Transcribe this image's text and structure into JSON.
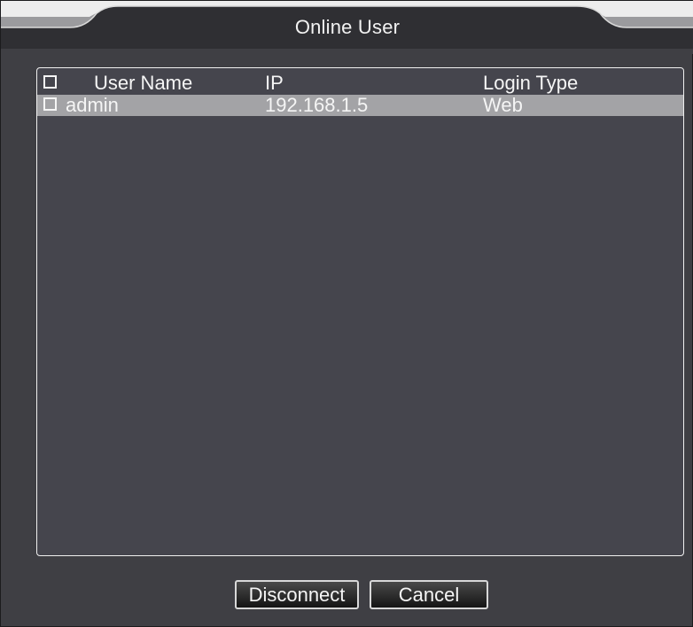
{
  "dialog": {
    "title": "Online User"
  },
  "table": {
    "columns": [
      "User Name",
      "IP",
      "Login Type"
    ],
    "rows": [
      {
        "user_name": "admin",
        "ip": "192.168.1.5",
        "login_type": "Web",
        "checked": false,
        "selected": true
      }
    ]
  },
  "buttons": {
    "disconnect": "Disconnect",
    "cancel": "Cancel"
  },
  "colors": {
    "panel_bg": "#45454d",
    "selected_row": "#a3a3a6",
    "title_bg": "#3f3f44",
    "text": "#f5f5f5"
  }
}
